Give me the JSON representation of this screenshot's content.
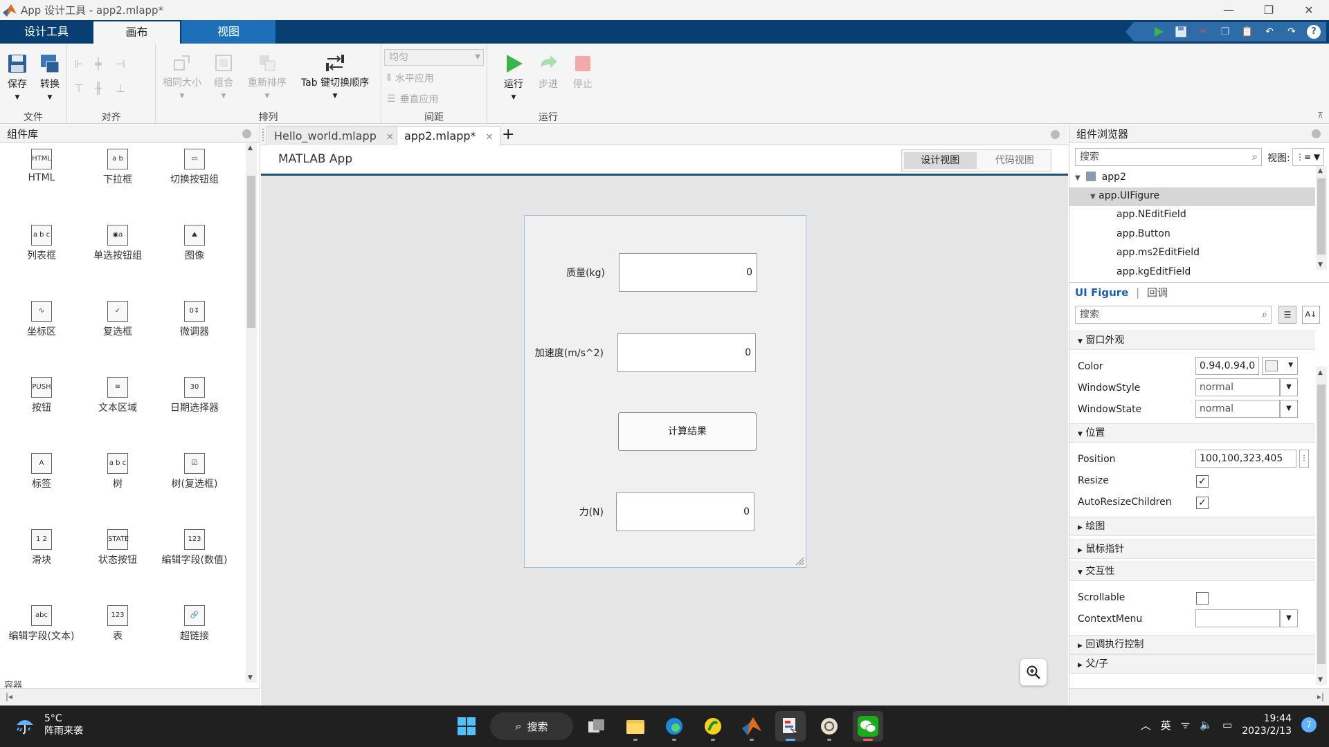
{
  "window": {
    "title": "App 设计工具 - app2.mlapp*",
    "controls": [
      "—",
      "❐",
      "✕"
    ]
  },
  "ribbon_tabs": [
    "设计工具",
    "画布",
    "视图"
  ],
  "ribbon": {
    "file": {
      "label": "文件",
      "save": "保存",
      "convert": "转换"
    },
    "align": {
      "label": "对齐"
    },
    "arrange": {
      "label": "排列",
      "same_size": "相同大小",
      "group": "组合",
      "reorder": "重新排序",
      "tab_order": "Tab 键切换顺序"
    },
    "spacing": {
      "label": "间距",
      "select": "均匀",
      "horizontal": "水平应用",
      "vertical": "垂直应用"
    },
    "run": {
      "label": "运行",
      "run": "运行",
      "step": "步进",
      "stop": "停止"
    }
  },
  "left_panel": {
    "title": "组件库",
    "components": [
      {
        "label": "HTML",
        "icon": "HTML"
      },
      {
        "label": "下拉框",
        "icon": "a b"
      },
      {
        "label": "切换按钮组",
        "icon": "▭"
      },
      {
        "label": "列表框",
        "icon": "a b c"
      },
      {
        "label": "单选按钮组",
        "icon": "◉a"
      },
      {
        "label": "图像",
        "icon": "⛰"
      },
      {
        "label": "坐标区",
        "icon": "∿"
      },
      {
        "label": "复选框",
        "icon": "✓"
      },
      {
        "label": "微调器",
        "icon": "0⇕"
      },
      {
        "label": "按钮",
        "icon": "PUSH"
      },
      {
        "label": "文本区域",
        "icon": "≡"
      },
      {
        "label": "日期选择器",
        "icon": "30"
      },
      {
        "label": "标签",
        "icon": "A"
      },
      {
        "label": "树",
        "icon": "a b c"
      },
      {
        "label": "树(复选框)",
        "icon": "☑"
      },
      {
        "label": "滑块",
        "icon": "1 2"
      },
      {
        "label": "状态按钮",
        "icon": "STATE"
      },
      {
        "label": "编辑字段(数值)",
        "icon": "123"
      },
      {
        "label": "编辑字段(文本)",
        "icon": "abc"
      },
      {
        "label": "表",
        "icon": "123"
      },
      {
        "label": "超链接",
        "icon": "🔗"
      }
    ],
    "next_section": "容器"
  },
  "center": {
    "tabs": [
      {
        "label": "Hello_world.mlapp",
        "close": "✕"
      },
      {
        "label": "app2.mlapp*",
        "close": "✕"
      }
    ],
    "add_tab": "+",
    "app_title": "MATLAB App",
    "design_view": "设计视图",
    "code_view": "代码视图",
    "figure": {
      "mass_label": "质量(kg)",
      "mass_value": "0",
      "accel_label": "加速度(m/s^2)",
      "accel_value": "0",
      "button_label": "计算结果",
      "force_label": "力(N)",
      "force_value": "0"
    }
  },
  "right_panel": {
    "title": "组件浏览器",
    "search_placeholder": "搜索",
    "view_label": "视图:",
    "tree": [
      "app2",
      "app.UIFigure",
      "app.NEditField",
      "app.Button",
      "app.ms2EditField",
      "app.kgEditField"
    ],
    "inspector_tab": "UI Figure",
    "callback_tab": "回调",
    "inspector_search": "搜索",
    "sections": {
      "window_appearance": "窗口外观",
      "position": "位置",
      "plotting": "绘图",
      "mouse_pointer": "鼠标指针",
      "interactivity": "交互性",
      "callback_exec": "回调执行控制",
      "parent_child": "父/子"
    },
    "props": {
      "color_name": "Color",
      "color_value": "0.94,0.94,0",
      "window_style_name": "WindowStyle",
      "window_style_value": "normal",
      "window_state_name": "WindowState",
      "window_state_value": "normal",
      "position_name": "Position",
      "position_value": "100,100,323,405",
      "resize_name": "Resize",
      "auto_resize_name": "AutoResizeChildren",
      "scrollable_name": "Scrollable",
      "context_menu_name": "ContextMenu"
    }
  },
  "taskbar": {
    "temp": "5°C",
    "weather": "阵雨来袭",
    "search": "搜索",
    "ime": "英",
    "time": "19:44",
    "date": "2023/2/13",
    "notifications": "7"
  }
}
